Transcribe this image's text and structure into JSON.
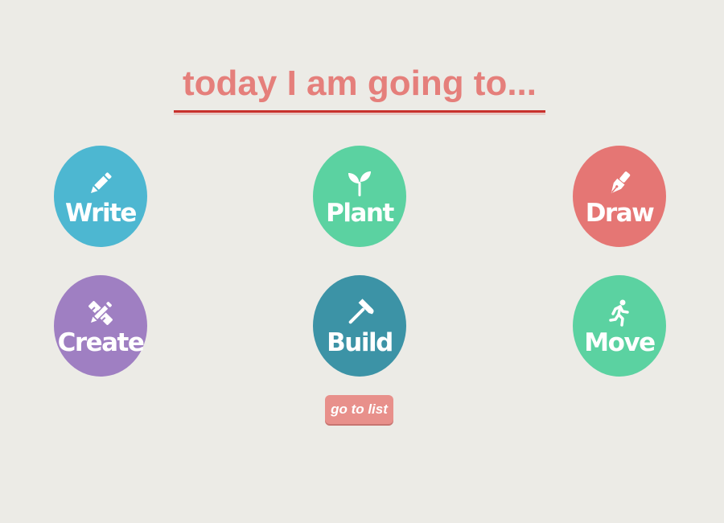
{
  "header": {
    "title": "today I am going to..."
  },
  "activities": [
    {
      "label": "Write",
      "icon": "pencil-icon",
      "color": "#4db7d1"
    },
    {
      "label": "Plant",
      "icon": "sprout-icon",
      "color": "#5bd2a1"
    },
    {
      "label": "Draw",
      "icon": "pen-nib-icon",
      "color": "#e57674"
    },
    {
      "label": "Create",
      "icon": "ruler-pencil-icon",
      "color": "#9f7fc2"
    },
    {
      "label": "Build",
      "icon": "hammer-icon",
      "color": "#3c93a6"
    },
    {
      "label": "Move",
      "icon": "running-person-icon",
      "color": "#5bd2a1"
    }
  ],
  "actions": {
    "go_to_list_label": "go to list"
  },
  "colors": {
    "background": "#ecebe6",
    "title": "#e57f7b",
    "title_underline": "#c8312c",
    "button": "#e8908b"
  }
}
